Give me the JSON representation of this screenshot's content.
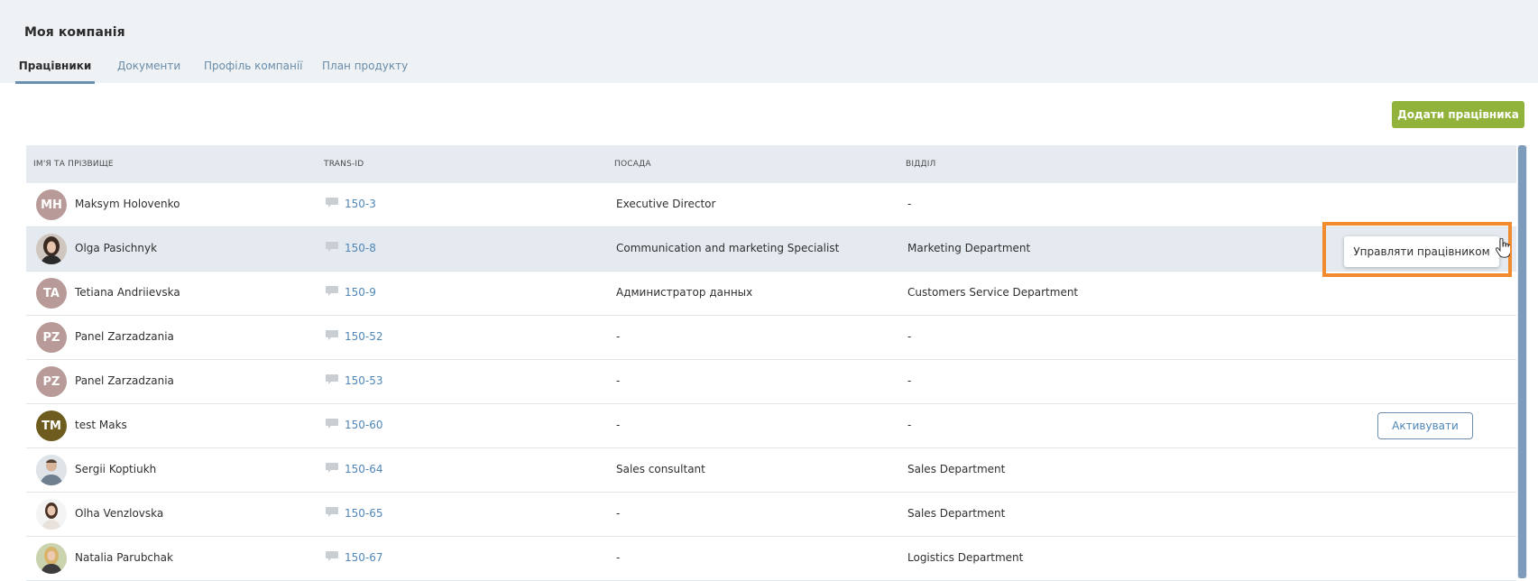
{
  "page": {
    "title": "Моя компанія"
  },
  "tabs": [
    {
      "label": "Працівники",
      "active": true
    },
    {
      "label": "Документи",
      "active": false
    },
    {
      "label": "Профіль компанії",
      "active": false
    },
    {
      "label": "План продукту",
      "active": false
    }
  ],
  "toolbar": {
    "add_label": "Додати працівника"
  },
  "table": {
    "columns": [
      "Ім'я та прізвище",
      "Trans-ID",
      "Посада",
      "Відділ"
    ],
    "rows": [
      {
        "initials": "MH",
        "name": "Maksym Holovenko",
        "trans_id": "150-3",
        "position": "Executive Director",
        "department": "-"
      },
      {
        "initials": "",
        "name": "Olga Pasichnyk",
        "trans_id": "150-8",
        "position": "Communication and marketing Specialist",
        "department": "Marketing Department"
      },
      {
        "initials": "TA",
        "name": "Tetiana Andriievska",
        "trans_id": "150-9",
        "position": "Администратор данных",
        "department": "Customers Service Department"
      },
      {
        "initials": "PZ",
        "name": "Panel Zarzadzania",
        "trans_id": "150-52",
        "position": "-",
        "department": "-"
      },
      {
        "initials": "PZ",
        "name": "Panel Zarzadzania",
        "trans_id": "150-53",
        "position": "-",
        "department": "-"
      },
      {
        "initials": "TM",
        "name": "test Maks",
        "trans_id": "150-60",
        "position": "-",
        "department": "-"
      },
      {
        "initials": "",
        "name": "Sergii Koptiukh",
        "trans_id": "150-64",
        "position": "Sales consultant",
        "department": "Sales Department"
      },
      {
        "initials": "",
        "name": "Olha Venzlovska",
        "trans_id": "150-65",
        "position": "-",
        "department": "Sales Department"
      },
      {
        "initials": "",
        "name": "Natalia Parubchak",
        "trans_id": "150-67",
        "position": "-",
        "department": "Logistics Department"
      }
    ]
  },
  "actions": {
    "manage_label": "Управляти працівником",
    "activate_label": "Активувати"
  },
  "colors": {
    "accent_green": "#92b33b",
    "link_blue": "#4f86b8",
    "highlight_orange": "#f28a2e",
    "avatar_mauve": "#b89a98",
    "avatar_olive": "#6e5b1e"
  }
}
